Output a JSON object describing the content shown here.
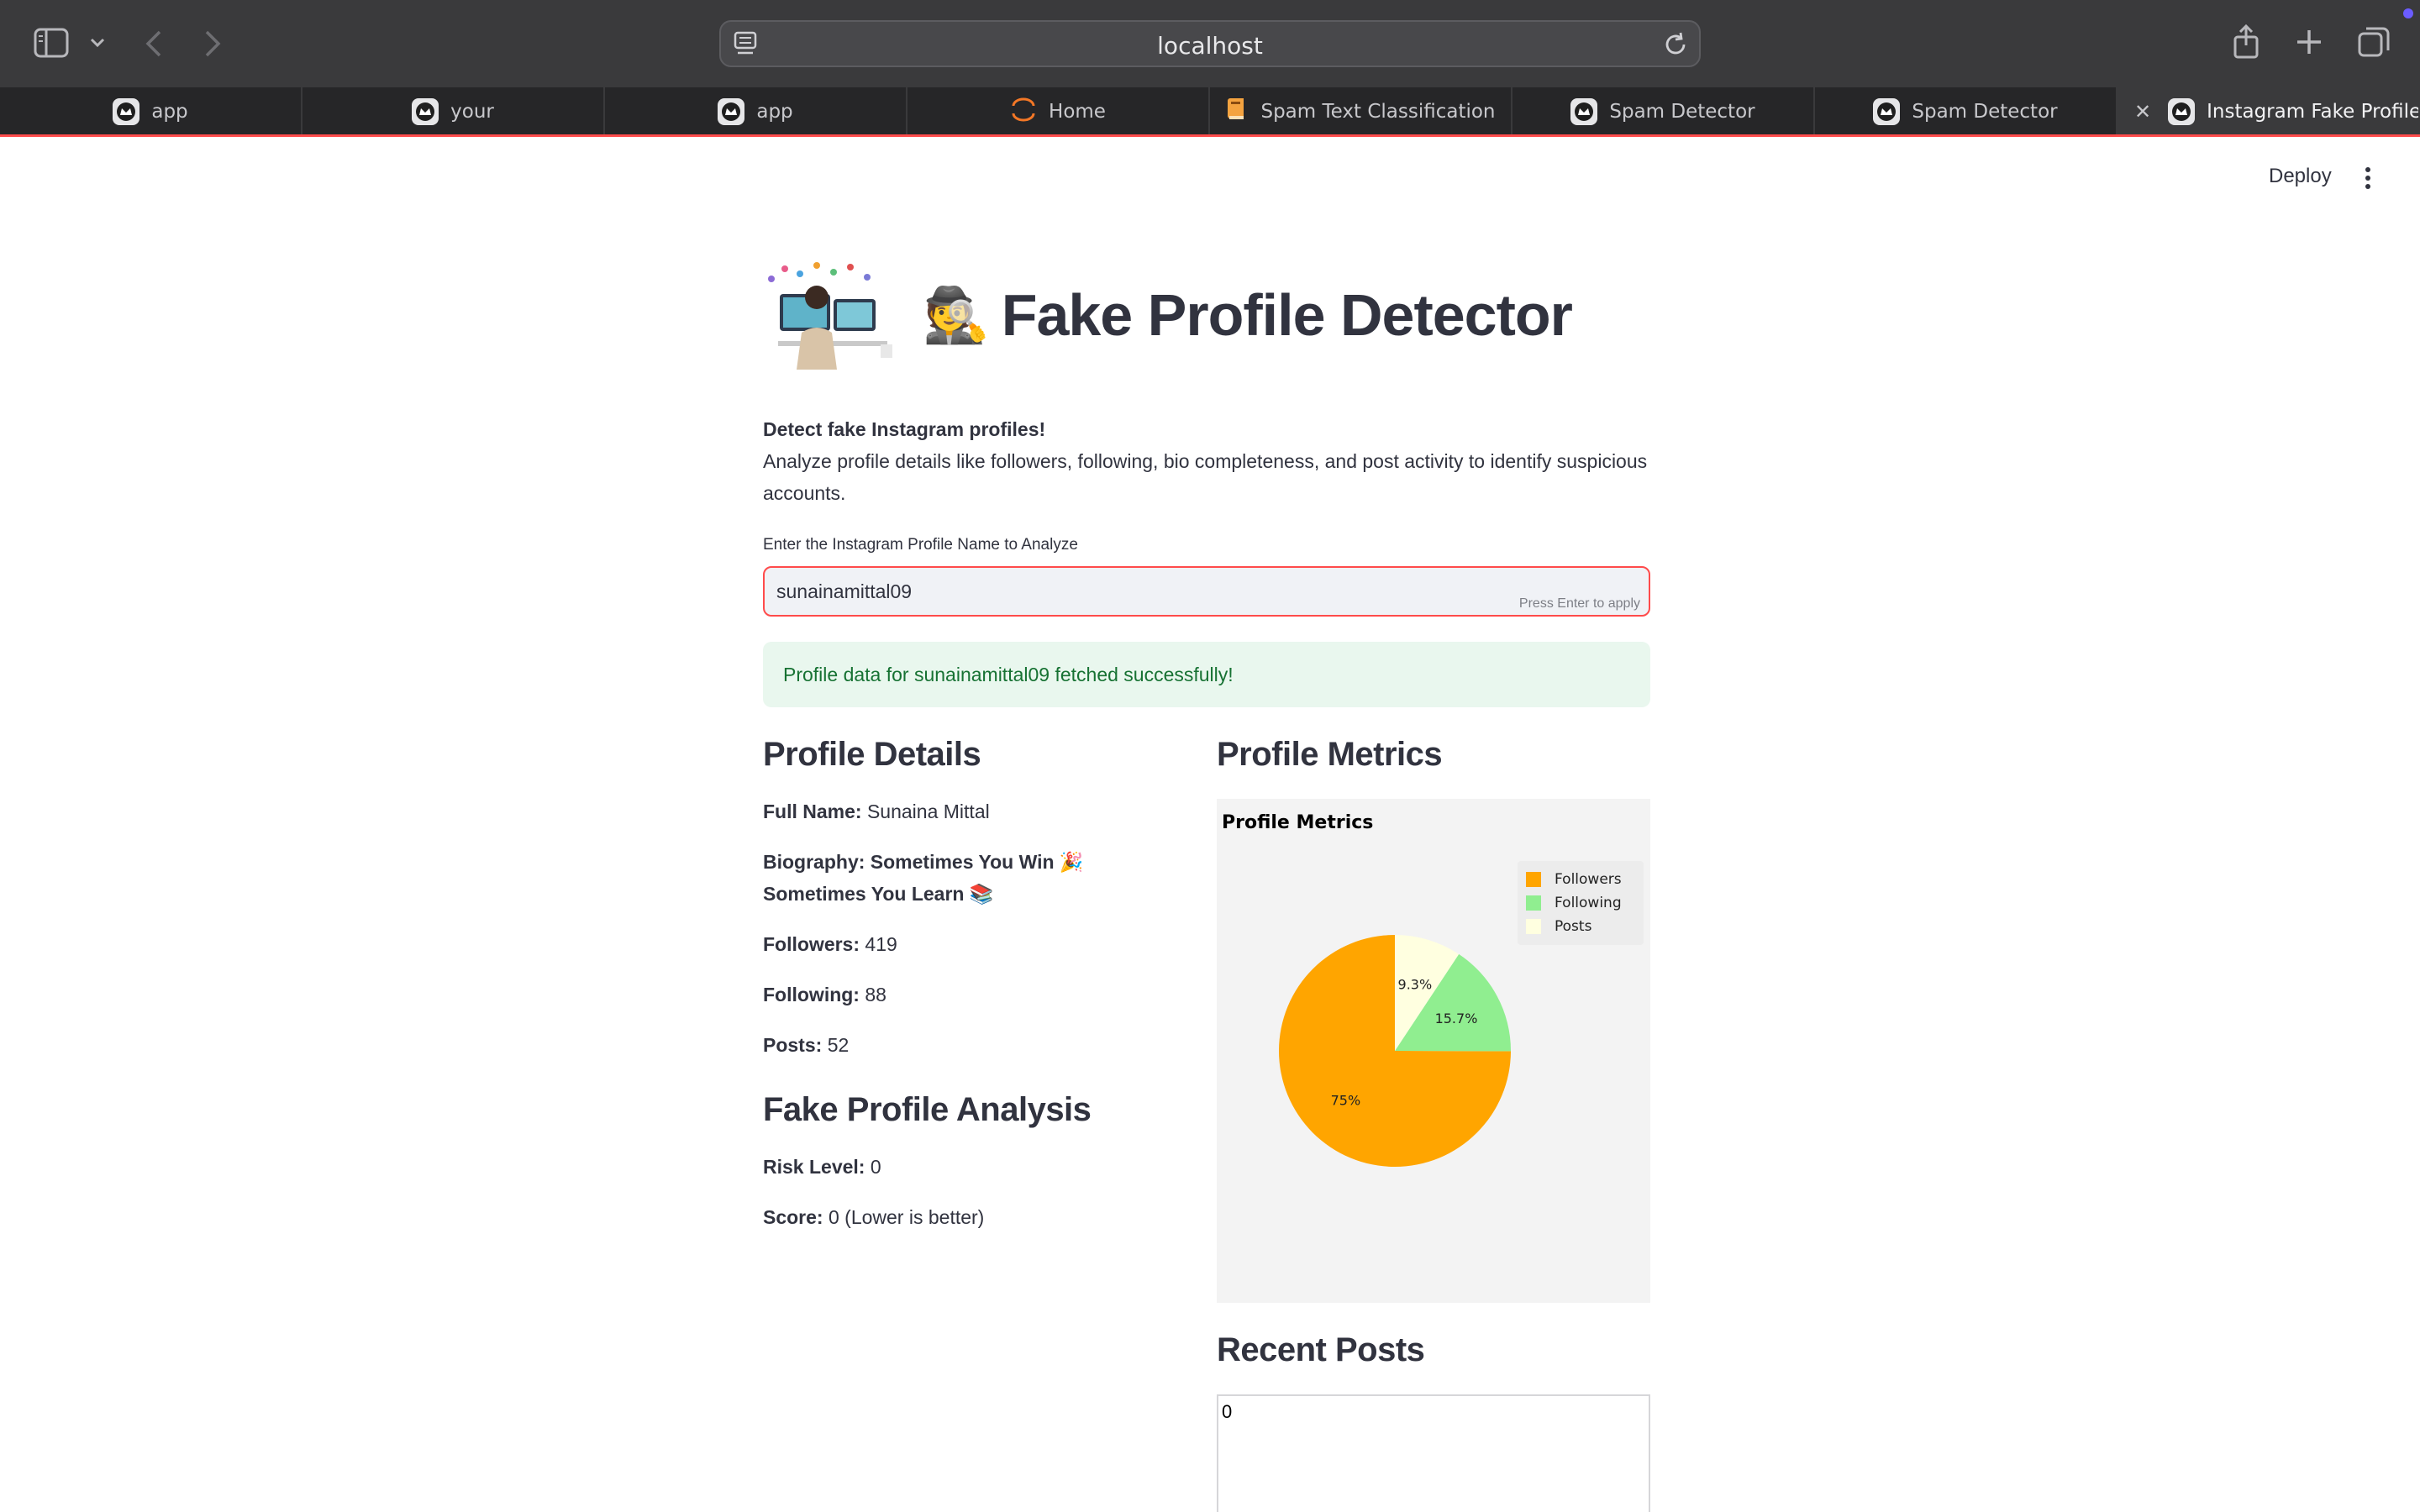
{
  "browser": {
    "url": "localhost",
    "tabs": [
      {
        "label": "app",
        "icon": "streamlit-crown-icon"
      },
      {
        "label": "your",
        "icon": "streamlit-crown-icon"
      },
      {
        "label": "app",
        "icon": "streamlit-crown-icon"
      },
      {
        "label": "Home",
        "icon": "jupyter-icon"
      },
      {
        "label": "Spam Text Classification",
        "icon": "book-icon"
      },
      {
        "label": "Spam Detector",
        "icon": "streamlit-crown-icon"
      },
      {
        "label": "Spam Detector",
        "icon": "streamlit-crown-icon"
      },
      {
        "label": "Instagram Fake Profile...",
        "icon": "streamlit-crown-icon",
        "active": true
      }
    ]
  },
  "header": {
    "deploy_label": "Deploy"
  },
  "page": {
    "title_emoji": "🕵️",
    "title": "Fake Profile Detector",
    "intro_bold": "Detect fake Instagram profiles!",
    "intro_text": "Analyze profile details like followers, following, bio completeness, and post activity to identify suspicious accounts.",
    "input_label": "Enter the Instagram Profile Name to Analyze",
    "input_value": "sunainamittal09",
    "input_hint": "Press Enter to apply",
    "success_message": "Profile data for sunainamittal09 fetched successfully!"
  },
  "profile_details": {
    "heading": "Profile Details",
    "full_name_label": "Full Name:",
    "full_name": "Sunaina Mittal",
    "biography_label": "Biography:",
    "biography": "Sometimes You Win 🎉 Sometimes You Learn 📚",
    "followers_label": "Followers:",
    "followers": "419",
    "following_label": "Following:",
    "following": "88",
    "posts_label": "Posts:",
    "posts": "52"
  },
  "analysis": {
    "heading": "Fake Profile Analysis",
    "risk_label": "Risk Level:",
    "risk_value": "0",
    "score_label": "Score:",
    "score_value": "0 (Lower is better)"
  },
  "metrics": {
    "heading": "Profile Metrics"
  },
  "chart_data": {
    "type": "pie",
    "title": "Profile Metrics",
    "categories": [
      "Followers",
      "Following",
      "Posts"
    ],
    "values": [
      419,
      88,
      52
    ],
    "percent_labels": [
      "75%",
      "15.7%",
      "9.3%"
    ],
    "colors": [
      "#ffa500",
      "#90ee90",
      "#ffffe0"
    ],
    "legend": "top-right"
  },
  "recent_posts": {
    "heading": "Recent Posts",
    "content": "0"
  }
}
